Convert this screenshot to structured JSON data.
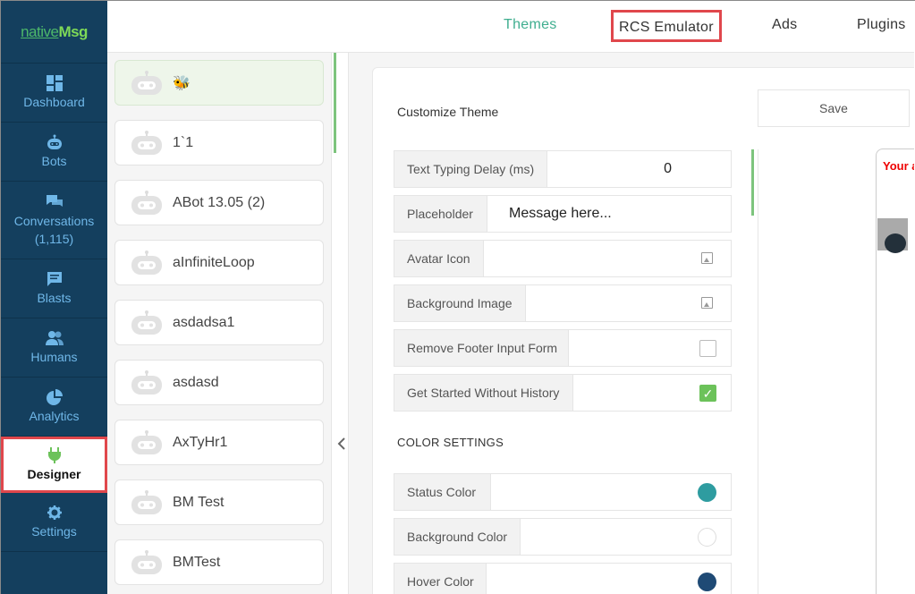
{
  "brand": {
    "native": "native",
    "msg": "Msg"
  },
  "sidebar": {
    "items": [
      {
        "label": "Dashboard",
        "icon": "dashboard-icon"
      },
      {
        "label": "Bots",
        "icon": "bot-icon"
      },
      {
        "label": "Conversations",
        "count": "(1,115)",
        "icon": "chat-icon"
      },
      {
        "label": "Blasts",
        "icon": "message-icon"
      },
      {
        "label": "Humans",
        "icon": "people-icon"
      },
      {
        "label": "Analytics",
        "icon": "pie-chart-icon"
      },
      {
        "label": "Designer",
        "icon": "plug-icon",
        "active": true
      },
      {
        "label": "Settings",
        "icon": "gear-icon"
      }
    ]
  },
  "header": {
    "tabs": [
      {
        "label": "Themes"
      },
      {
        "label": "RCS Emulator"
      },
      {
        "label": "Ads"
      },
      {
        "label": "Plugins"
      }
    ]
  },
  "bots": [
    {
      "name": "🐝"
    },
    {
      "name": "1`1"
    },
    {
      "name": "ABot 13.05 (2)"
    },
    {
      "name": "aInfiniteLoop"
    },
    {
      "name": "asdadsa1"
    },
    {
      "name": "asdasd"
    },
    {
      "name": "AxTyHr1"
    },
    {
      "name": "BM Test"
    },
    {
      "name": "BMTest"
    }
  ],
  "theme": {
    "title": "Customize Theme",
    "save_label": "Save",
    "fields": {
      "typing_delay_label": "Text Typing Delay (ms)",
      "typing_delay_value": "0",
      "placeholder_label": "Placeholder",
      "placeholder_value": "Message here...",
      "avatar_label": "Avatar Icon",
      "background_image_label": "Background Image",
      "remove_footer_label": "Remove Footer Input Form",
      "remove_footer_checked": false,
      "get_started_label": "Get Started Without History",
      "get_started_checked": true
    },
    "color_settings_title": "COLOR SETTINGS",
    "colors": [
      {
        "label": "Status Color",
        "value": "#2e9ca0"
      },
      {
        "label": "Background Color",
        "value": "#ffffff"
      },
      {
        "label": "Hover Color",
        "value": "#1f4a75"
      }
    ]
  },
  "preview": {
    "text": "Your a"
  },
  "palette": {
    "sidebar": "#143f5e",
    "accent_green": "#3fae8f",
    "highlight_red": "#e0474c"
  }
}
